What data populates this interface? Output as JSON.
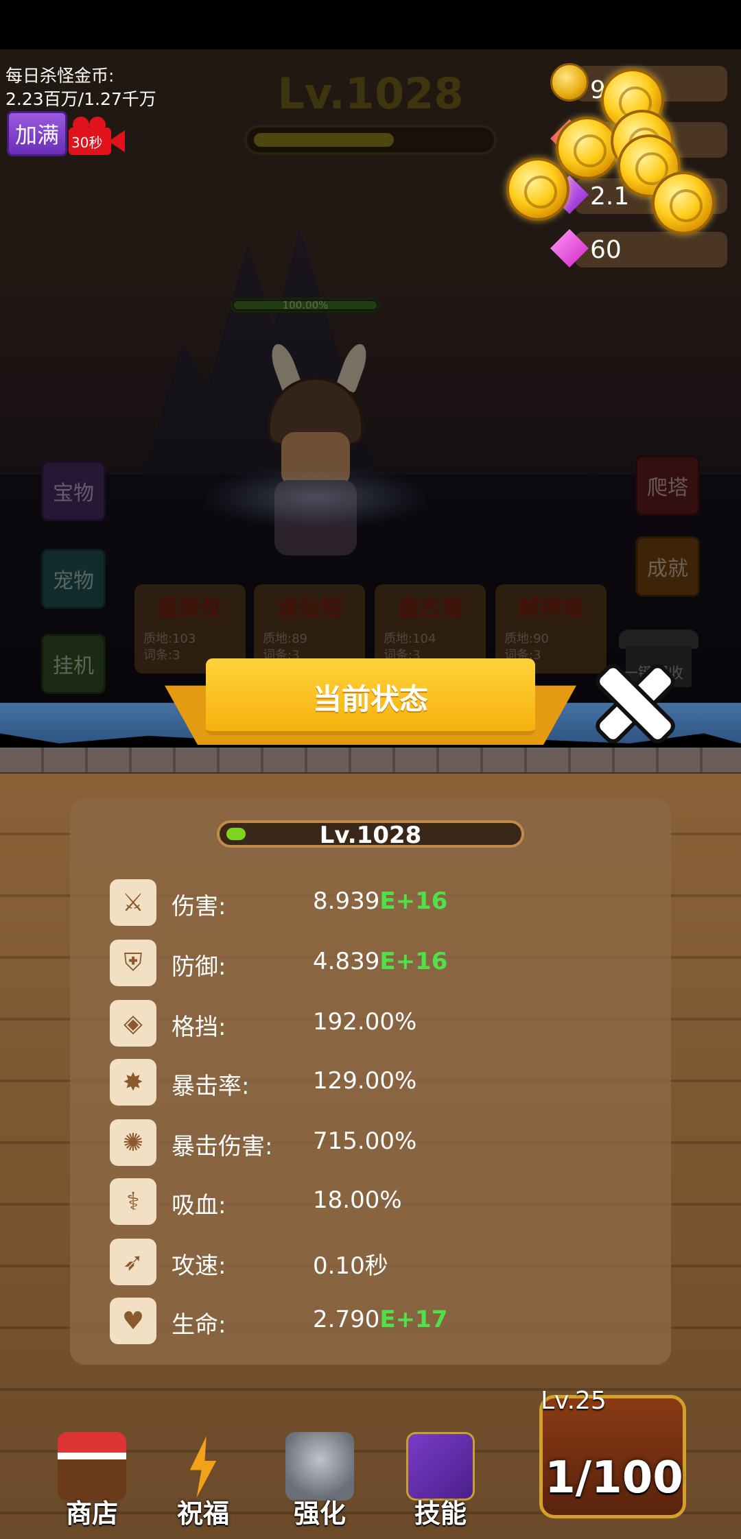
{
  "top": {
    "daily_label": "每日杀怪金币:",
    "daily_value": "2.23百万/1.27千万",
    "fill_button": "加满",
    "video_timer": "30秒",
    "level": "Lv.1028",
    "xp_fraction": 0.6
  },
  "currencies": [
    {
      "icon": "gold-coin-icon",
      "value": "96 万"
    },
    {
      "icon": "red-gem-icon",
      "value": ""
    },
    {
      "icon": "purple-gem-icon",
      "value": "2.1"
    },
    {
      "icon": "pink-diamond-icon",
      "value": "60"
    }
  ],
  "battle": {
    "hp_text": "100.00%",
    "hp_fraction": 1.0
  },
  "side_buttons": {
    "treasure": "宝物",
    "pet": "宠物",
    "idle": "挂机",
    "tower": "爬塔",
    "achievement": "成就"
  },
  "equipment": [
    {
      "name": "星辰仗",
      "quality": "质地:103",
      "words": "词条:3"
    },
    {
      "name": "诛仙铠",
      "quality": "质地:89",
      "words": "词条:3"
    },
    {
      "name": "盘古盾",
      "quality": "质地:104",
      "words": "词条:3"
    },
    {
      "name": "弑神戒",
      "quality": "质地:90",
      "words": "词条:3"
    }
  ],
  "recycle_label": "一键回收",
  "popup": {
    "title": "当前状态",
    "level": "Lv.1028",
    "level_fraction": 0.05,
    "stats": [
      {
        "icon": "sword-icon",
        "label": "伤害:",
        "value": "8.939",
        "exp": "E+16"
      },
      {
        "icon": "shield-icon",
        "label": "防御:",
        "value": "4.839",
        "exp": "E+16"
      },
      {
        "icon": "block-shield-icon",
        "label": "格挡:",
        "value": "192.00%",
        "exp": ""
      },
      {
        "icon": "crit-burst-icon",
        "label": "暴击率:",
        "value": "129.00%",
        "exp": ""
      },
      {
        "icon": "crit-damage-icon",
        "label": "暴击伤害:",
        "value": "715.00%",
        "exp": ""
      },
      {
        "icon": "lifesteal-sword-icon",
        "label": "吸血:",
        "value": "18.00%",
        "exp": ""
      },
      {
        "icon": "attack-speed-icon",
        "label": "攻速:",
        "value": "0.10秒",
        "exp": ""
      },
      {
        "icon": "heart-plus-icon",
        "label": "生命:",
        "value": "2.790",
        "exp": "E+17"
      }
    ]
  },
  "nav": {
    "shop": "商店",
    "bless": "祝福",
    "forge": "强化",
    "skill": "技能",
    "chest_level": "Lv.25",
    "chest_count": "1/100"
  },
  "colors": {
    "exponent_green": "#4fe04a",
    "banner_yellow": "#ffd23a",
    "panel_brown": "#8c6844"
  }
}
